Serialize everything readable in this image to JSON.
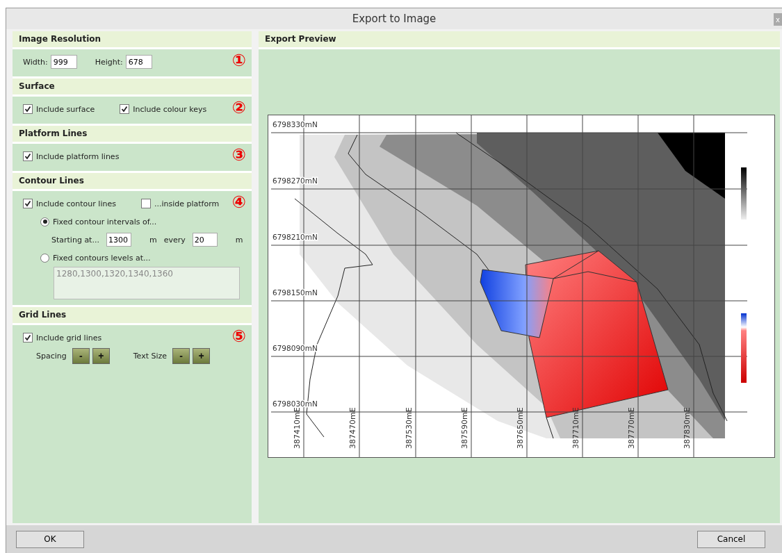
{
  "window": {
    "title": "Export to Image",
    "close": "x"
  },
  "sections": [
    {
      "title": "Image Resolution",
      "marker": "①",
      "rows": [
        {
          "kind": "main",
          "items": [
            {
              "kind": "field",
              "label": "Width:",
              "value": "999"
            },
            {
              "kind": "field",
              "label": "Height:",
              "value": "678"
            }
          ]
        }
      ]
    },
    {
      "title": "Surface",
      "marker": "②",
      "rows": [
        {
          "kind": "main",
          "items": [
            {
              "kind": "checkbox",
              "label": "Include surface",
              "checked": true
            },
            {
              "kind": "checkbox",
              "label": "Include colour keys",
              "checked": true
            }
          ]
        }
      ]
    },
    {
      "title": "Platform Lines",
      "marker": "③",
      "rows": [
        {
          "kind": "main",
          "items": [
            {
              "kind": "checkbox",
              "label": "Include platform lines",
              "checked": true
            }
          ]
        }
      ]
    },
    {
      "title": "Contour Lines",
      "marker": "④",
      "rows": [
        {
          "kind": "main",
          "items": [
            {
              "kind": "checkbox",
              "label": "Include contour lines",
              "checked": true
            },
            {
              "kind": "checkbox",
              "label": "...inside platform",
              "checked": false
            }
          ]
        },
        {
          "kind": "option",
          "items": [
            {
              "kind": "radio",
              "label": "Fixed contour intervals of...",
              "selected": true
            }
          ]
        },
        {
          "kind": "sub",
          "items": [
            {
              "kind": "text",
              "label": "Starting at..."
            },
            {
              "kind": "field",
              "value": "1300"
            },
            {
              "kind": "text",
              "label": "m"
            },
            {
              "kind": "text",
              "label": "every"
            },
            {
              "kind": "field",
              "value": "20"
            },
            {
              "kind": "text",
              "label": "m"
            }
          ]
        },
        {
          "kind": "option",
          "items": [
            {
              "kind": "radio",
              "label": "Fixed contours levels at...",
              "selected": false
            }
          ]
        },
        {
          "kind": "area",
          "items": [
            {
              "kind": "textarea",
              "value": "1280,1300,1320,1340,1360",
              "disabled": true
            }
          ]
        }
      ]
    },
    {
      "title": "Grid Lines",
      "marker": "⑤",
      "rows": [
        {
          "kind": "main",
          "items": [
            {
              "kind": "checkbox",
              "label": "Include grid lines",
              "checked": true
            }
          ]
        },
        {
          "kind": "buttons",
          "items": [
            {
              "kind": "text",
              "label": "Spacing"
            },
            {
              "kind": "button",
              "label": "-"
            },
            {
              "kind": "button",
              "label": "+"
            },
            {
              "kind": "text",
              "label": "Text Size"
            },
            {
              "kind": "button",
              "label": "-"
            },
            {
              "kind": "button",
              "label": "+"
            }
          ]
        }
      ]
    }
  ],
  "preview": {
    "title": "Export Preview",
    "map": {
      "northings": [
        "6798330mN",
        "6798270mN",
        "6798210mN",
        "6798150mN",
        "6798090mN",
        "6798030mN"
      ],
      "eastings": [
        "387410mE",
        "387470mE",
        "387530mE",
        "387590mE",
        "387650mE",
        "387710mE",
        "387770mE",
        "387830mE"
      ]
    }
  },
  "buttons": [
    {
      "label": "OK"
    },
    {
      "label": "Cancel"
    }
  ]
}
